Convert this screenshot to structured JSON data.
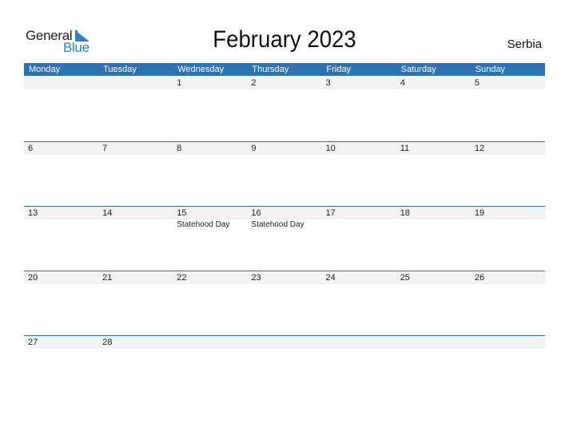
{
  "logo": {
    "part1": "General",
    "part2": "Blue"
  },
  "title": "February 2023",
  "country": "Serbia",
  "weekdays": [
    "Monday",
    "Tuesday",
    "Wednesday",
    "Thursday",
    "Friday",
    "Saturday",
    "Sunday"
  ],
  "colors": {
    "header": "#2e72b4",
    "band": "#f2f2f2",
    "logo_blue": "#2a7fd0"
  },
  "weeks": [
    [
      {
        "day": ""
      },
      {
        "day": ""
      },
      {
        "day": "1"
      },
      {
        "day": "2"
      },
      {
        "day": "3"
      },
      {
        "day": "4"
      },
      {
        "day": "5"
      }
    ],
    [
      {
        "day": "6"
      },
      {
        "day": "7"
      },
      {
        "day": "8"
      },
      {
        "day": "9"
      },
      {
        "day": "10"
      },
      {
        "day": "11"
      },
      {
        "day": "12"
      }
    ],
    [
      {
        "day": "13"
      },
      {
        "day": "14"
      },
      {
        "day": "15",
        "holiday": "Statehood Day"
      },
      {
        "day": "16",
        "holiday": "Statehood Day"
      },
      {
        "day": "17"
      },
      {
        "day": "18"
      },
      {
        "day": "19"
      }
    ],
    [
      {
        "day": "20"
      },
      {
        "day": "21"
      },
      {
        "day": "22"
      },
      {
        "day": "23"
      },
      {
        "day": "24"
      },
      {
        "day": "25"
      },
      {
        "day": "26"
      }
    ],
    [
      {
        "day": "27"
      },
      {
        "day": "28"
      },
      {
        "day": ""
      },
      {
        "day": ""
      },
      {
        "day": ""
      },
      {
        "day": ""
      },
      {
        "day": ""
      }
    ]
  ]
}
